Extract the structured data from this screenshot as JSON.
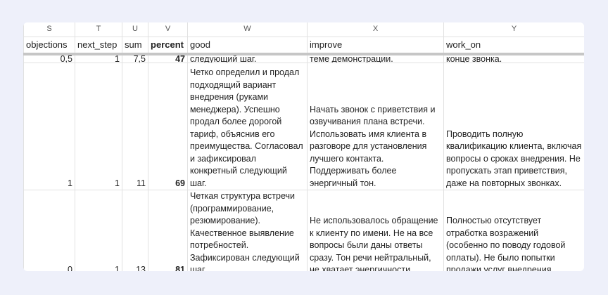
{
  "columns": {
    "letters": [
      "S",
      "T",
      "U",
      "V",
      "W",
      "X",
      "Y"
    ],
    "names": [
      "objections",
      "next_step",
      "sum",
      "percent",
      "good",
      "improve",
      "work_on"
    ]
  },
  "rows": [
    {
      "objections": "0,5",
      "next_step": "1",
      "sum": "7,5",
      "percent": "47",
      "good": "следующий шаг.",
      "improve": "теме демонстрации.",
      "work_on": "конце звонка."
    },
    {
      "objections": "1",
      "next_step": "1",
      "sum": "11",
      "percent": "69",
      "good": "Четко определил и продал подходящий вариант внедрения (руками менеджера). Успешно продал более дорогой тариф, объяснив его преимущества. Согласовал и зафиксировал конкретный следующий шаг.",
      "improve": "Начать звонок с приветствия и озвучивания плана встречи. Использовать имя клиента в разговоре для установления лучшего контакта. Поддерживать более энергичный тон.",
      "work_on": "Проводить полную квалификацию клиента, включая вопросы о сроках внедрения. Не пропускать этап приветствия, даже на повторных звонках."
    },
    {
      "objections": "0",
      "next_step": "1",
      "sum": "13",
      "percent": "81",
      "good": "Четкая структура встречи (программирование, резюмирование). Качественное выявление потребностей. Зафиксирован следующий шаг.",
      "improve": "Не использовалось обращение к клиенту по имени. Не на все вопросы были даны ответы сразу. Тон речи нейтральный, не хватает энергичности.",
      "work_on": "Полностью отсутствует отработка возражений (особенно по поводу годовой оплаты). Не было попытки продажи услуг внедрения."
    }
  ]
}
